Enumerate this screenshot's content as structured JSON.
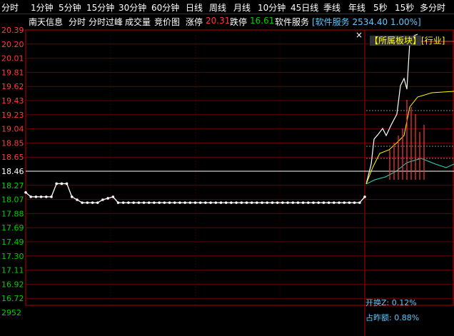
{
  "tabs": [
    "分时",
    "1分钟",
    "5分钟",
    "15分钟",
    "30分钟",
    "60分钟",
    "日线",
    "周线",
    "月线",
    "10分钟",
    "45日线",
    "季线",
    "年线",
    "5秒",
    "15秒",
    "多分时"
  ],
  "info": {
    "stock_name": "南天信息",
    "mode_a": "分时",
    "mode_b": "分时过峰",
    "volume": "成交量",
    "auction": "竞价图",
    "limit_up_label": "涨停",
    "limit_up_value": "20.31",
    "limit_down_label": "跌停",
    "limit_down_value": "16.61",
    "sector_label": "软件服务",
    "sector_index": "[软件服务 2534.40 1.00%]"
  },
  "y_axis": {
    "labels": [
      "20.39",
      "20.20",
      "20.01",
      "19.81",
      "19.62",
      "19.43",
      "19.23",
      "19.04",
      "18.85",
      "18.65",
      "18.46",
      "18.27",
      "18.07",
      "17.88",
      "17.69",
      "17.49",
      "17.30",
      "17.11",
      "16.92",
      "16.72",
      "2952"
    ],
    "prev_close": "18.46",
    "colors": {
      "up": "#ff3b3b",
      "base": "#ffffff",
      "down": "#00d000"
    }
  },
  "chart_data": {
    "type": "line",
    "title": "",
    "xlabel": "",
    "ylabel": "",
    "ylim": [
      16.53,
      20.39
    ],
    "prev_close": 18.46,
    "series": [
      {
        "values": [
          18.17,
          18.11,
          18.11,
          18.11,
          18.11,
          18.11,
          18.29,
          18.29,
          18.29,
          18.11,
          18.07,
          18.03,
          18.03,
          18.03,
          18.03,
          18.07,
          18.09,
          18.11,
          18.03,
          18.03,
          18.03,
          18.03,
          18.03,
          18.03,
          18.03,
          18.03,
          18.03,
          18.03,
          18.03,
          18.03,
          18.03,
          18.03,
          18.03,
          18.03,
          18.03,
          18.03,
          18.03,
          18.03,
          18.03,
          18.03,
          18.03,
          18.03,
          18.03,
          18.03,
          18.03,
          18.03,
          18.03,
          18.03,
          18.03,
          18.03,
          18.03,
          18.03,
          18.03,
          18.03,
          18.03,
          18.03,
          18.03,
          18.03,
          18.03,
          18.03,
          18.03,
          18.03,
          18.03,
          18.03,
          18.03,
          18.03,
          18.11
        ]
      }
    ]
  },
  "right_panel": {
    "title_bracket": "【所属板块】",
    "title_industry": "[行业]",
    "turnover_label": "开换Z",
    "turnover_value": "0.12%",
    "prev_amount_label": "占昨额",
    "prev_amount_value": "0.88%"
  },
  "close_icon": "×"
}
